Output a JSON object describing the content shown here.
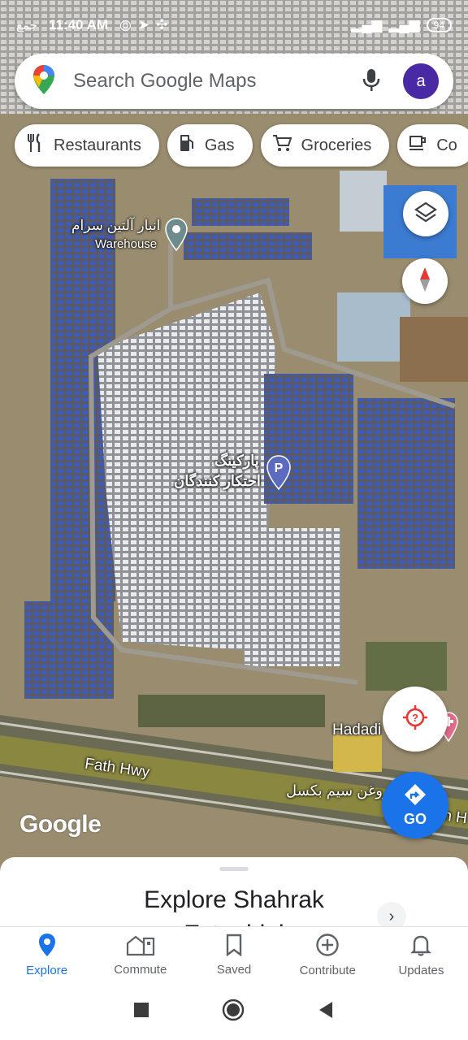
{
  "status_bar": {
    "time": "11:40 AM",
    "left_text": "جمع",
    "battery": "94"
  },
  "search": {
    "placeholder": "Search Google Maps",
    "avatar_letter": "a"
  },
  "chips": [
    {
      "label": "Restaurants",
      "icon": "fork-knife-icon"
    },
    {
      "label": "Gas",
      "icon": "gas-pump-icon"
    },
    {
      "label": "Groceries",
      "icon": "cart-icon"
    },
    {
      "label": "Co",
      "icon": "coffee-icon"
    }
  ],
  "map_labels": {
    "warehouse_fa": "انبار آلتین سرام",
    "warehouse_en": "Warehouse",
    "parking_line1": "پارکینگ",
    "parking_line2": "احتکار کنندگان",
    "hadadi": "Hadadi",
    "highway": "Fath Hwy",
    "shop_fa": "روغن سیم بکسل",
    "highway_right": "th H",
    "google": "Google"
  },
  "go_button": {
    "label": "GO"
  },
  "sheet": {
    "title": "Explore Shahrak",
    "subtitle": "Esteghlal"
  },
  "bottom_nav": [
    {
      "label": "Explore",
      "icon": "explore-pin-icon",
      "active": true
    },
    {
      "label": "Commute",
      "icon": "commute-icon",
      "active": false
    },
    {
      "label": "Saved",
      "icon": "bookmark-icon",
      "active": false
    },
    {
      "label": "Contribute",
      "icon": "add-circle-icon",
      "active": false
    },
    {
      "label": "Updates",
      "icon": "bell-icon",
      "active": false
    }
  ],
  "colors": {
    "accent": "#1a73e8",
    "avatar": "#4a2aa4",
    "compass_red": "#e53935",
    "locate_red": "#e53935"
  }
}
